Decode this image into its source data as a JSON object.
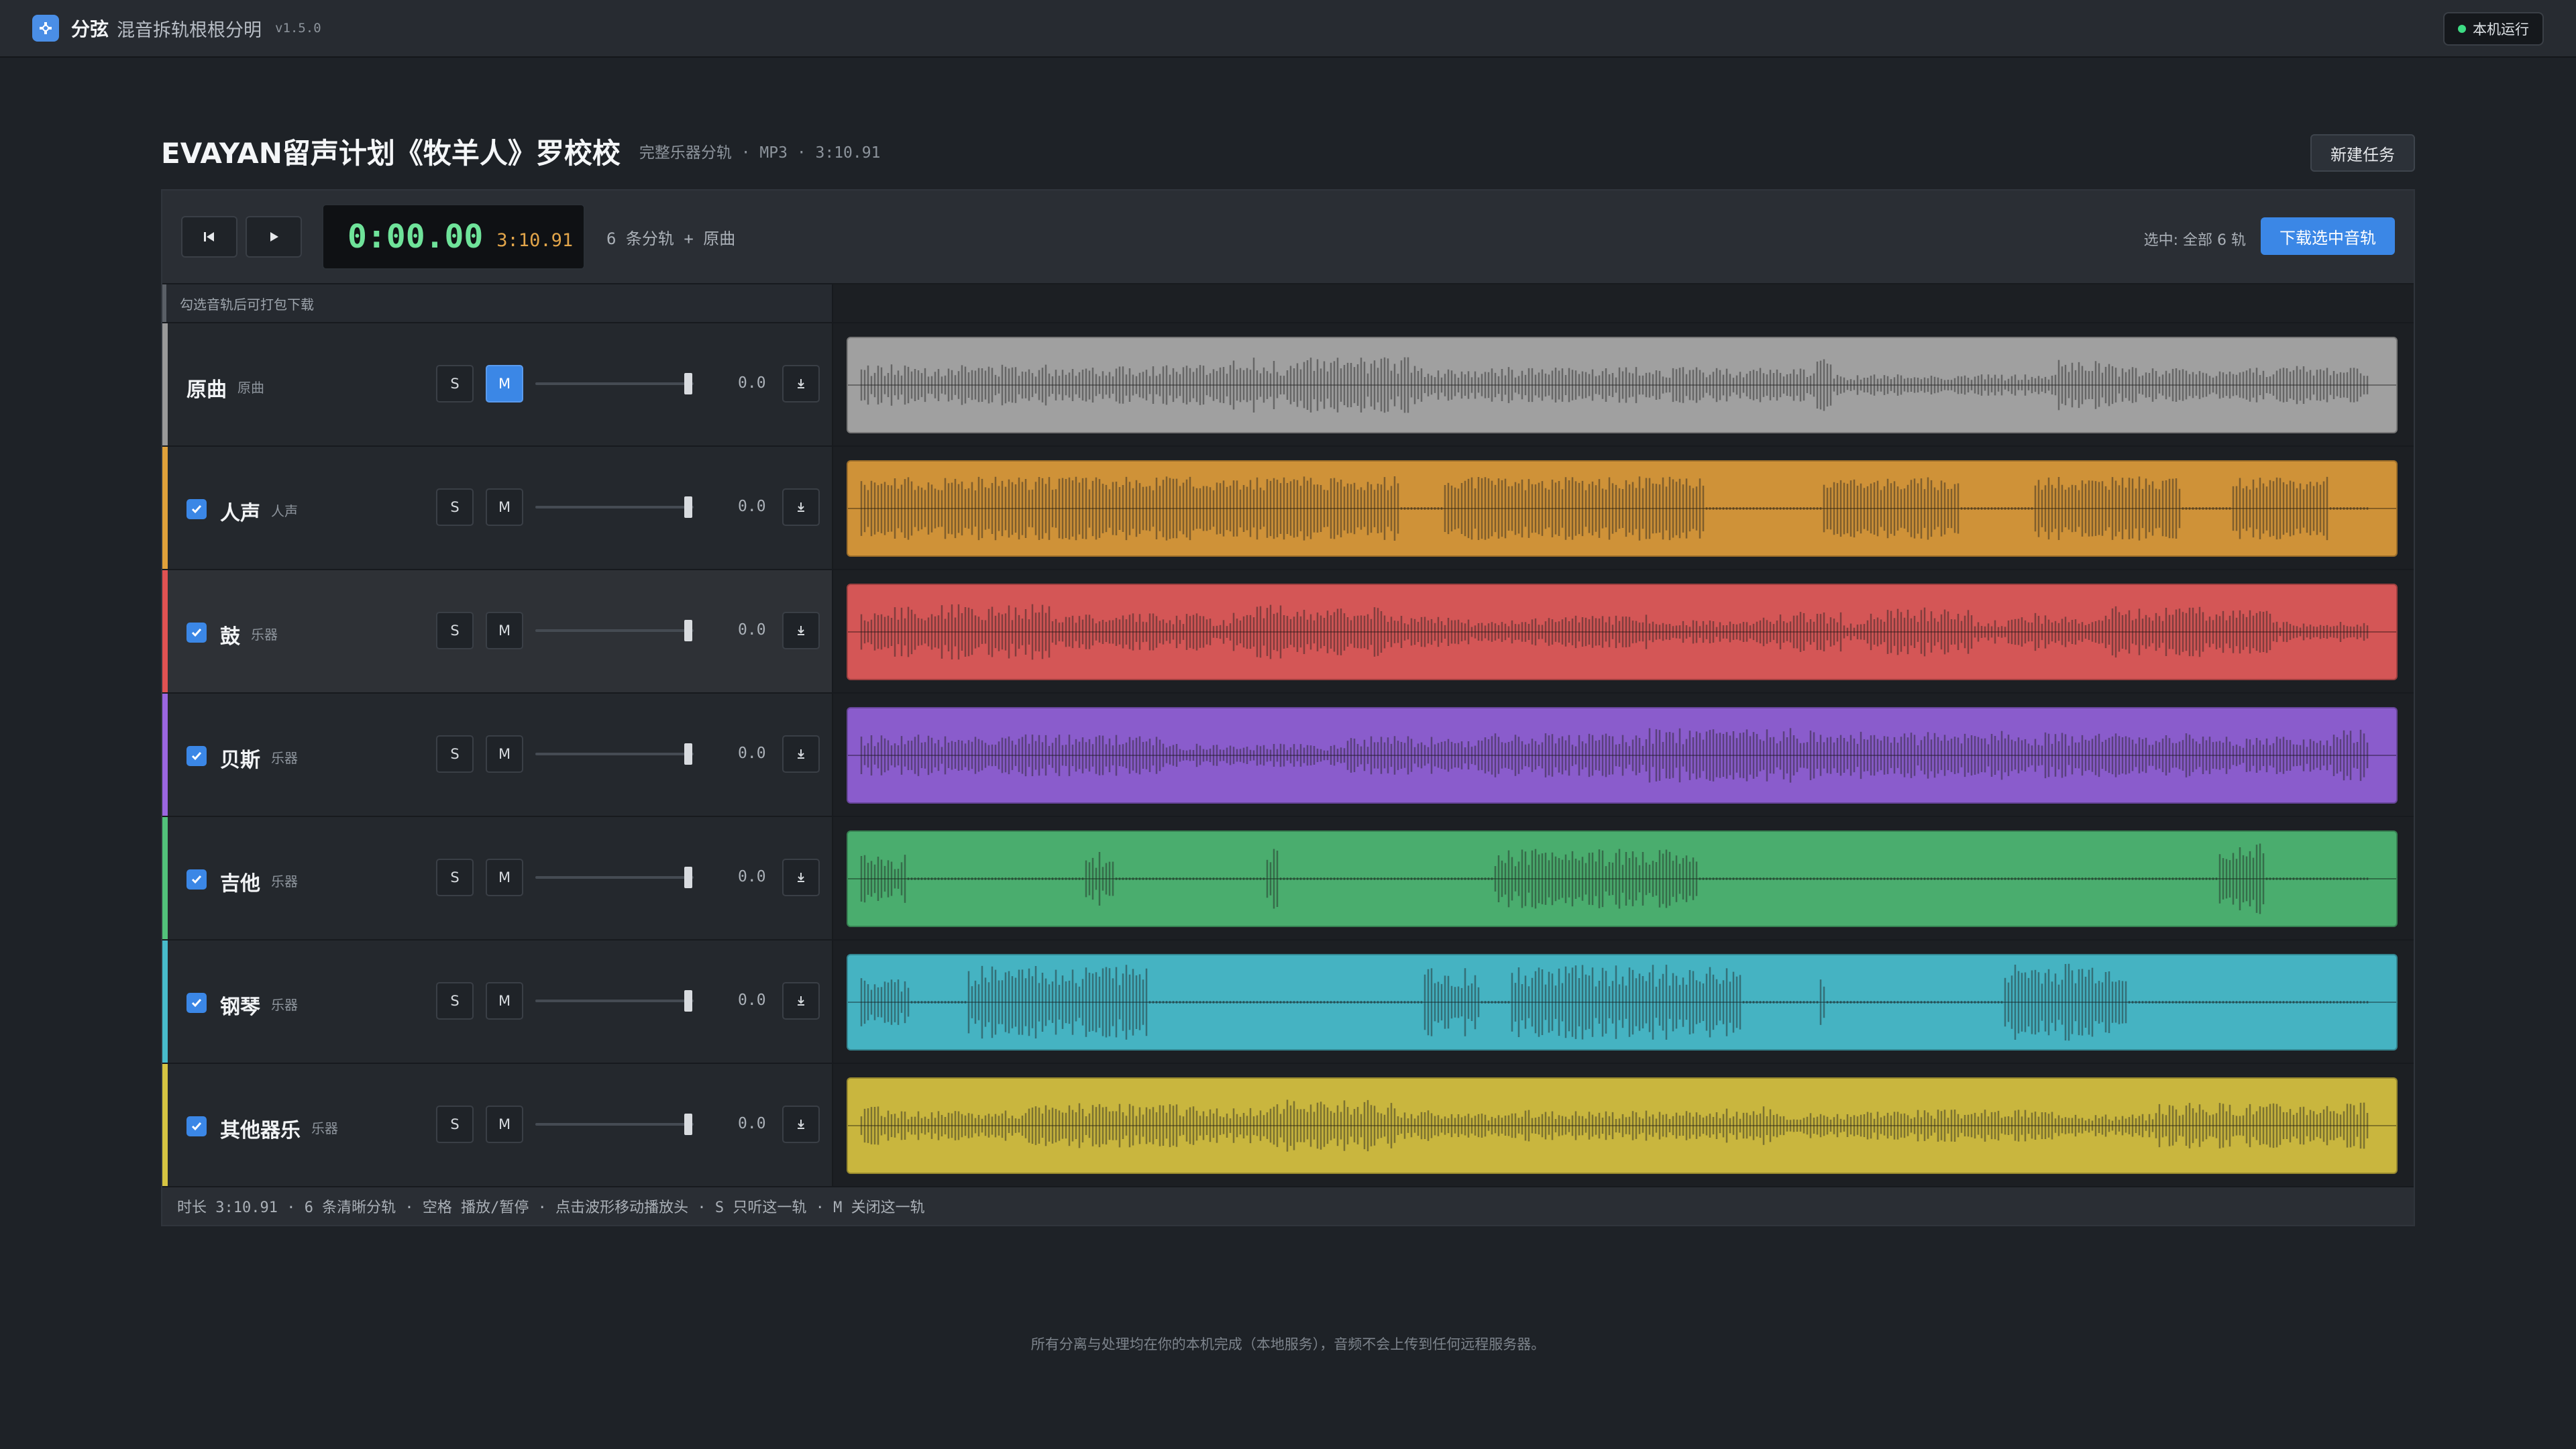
{
  "app": {
    "brand": "分弦",
    "subtitle": "混音拆轨根根分明",
    "version": "v1.5.0",
    "status_badge": "本机运行",
    "colors": {
      "accent": "#3b87e6",
      "status_ok": "#3ddc84"
    }
  },
  "header": {
    "title": "EVAYAN留声计划《牧羊人》罗校校",
    "meta": "完整乐器分轨 · MP3 · 3:10.91",
    "new_task_label": "新建任务"
  },
  "transport": {
    "prev_icon": "skip-back-icon",
    "play_icon": "play-icon",
    "current_time": "0:00.00",
    "total_time": "3:10.91",
    "tracks_summary": "6 条分轨 + 原曲",
    "selected_info": "选中: 全部 6 轨",
    "download_label": "下载选中音轨"
  },
  "hint": "勾选音轨后可打包下载",
  "tracks": [
    {
      "name": "原曲",
      "tag": "原曲",
      "has_checkbox": false,
      "checked": false,
      "solo_label": "S",
      "mute_label": "M",
      "muted": true,
      "volume": "0.0",
      "color": "#9a9a9a",
      "wave": "#a0a0a0"
    },
    {
      "name": "人声",
      "tag": "人声",
      "has_checkbox": true,
      "checked": true,
      "solo_label": "S",
      "mute_label": "M",
      "muted": false,
      "volume": "0.0",
      "color": "#e0a13a",
      "wave": "#cf9238"
    },
    {
      "name": "鼓",
      "tag": "乐器",
      "has_checkbox": true,
      "checked": true,
      "solo_label": "S",
      "mute_label": "M",
      "muted": false,
      "volume": "0.0",
      "color": "#e05252",
      "wave": "#d45656"
    },
    {
      "name": "贝斯",
      "tag": "乐器",
      "has_checkbox": true,
      "checked": true,
      "solo_label": "S",
      "mute_label": "M",
      "muted": false,
      "volume": "0.0",
      "color": "#9b66e0",
      "wave": "#8a5ccc"
    },
    {
      "name": "吉他",
      "tag": "乐器",
      "has_checkbox": true,
      "checked": true,
      "solo_label": "S",
      "mute_label": "M",
      "muted": false,
      "volume": "0.0",
      "color": "#52c27a",
      "wave": "#4aad6e"
    },
    {
      "name": "钢琴",
      "tag": "乐器",
      "has_checkbox": true,
      "checked": true,
      "solo_label": "S",
      "mute_label": "M",
      "muted": false,
      "volume": "0.0",
      "color": "#48bccb",
      "wave": "#45b3c2"
    },
    {
      "name": "其他器乐",
      "tag": "乐器",
      "has_checkbox": true,
      "checked": true,
      "solo_label": "S",
      "mute_label": "M",
      "muted": false,
      "volume": "0.0",
      "color": "#d6c442",
      "wave": "#c9b63e"
    }
  ],
  "status_bar": "时长 3:10.91 · 6 条清晰分轨 · 空格 播放/暂停 · 点击波形移动播放头 · S 只听这一轨 · M 关闭这一轨",
  "footer": "所有分离与处理均在你的本机完成（本地服务），音频不会上传到任何远程服务器。"
}
